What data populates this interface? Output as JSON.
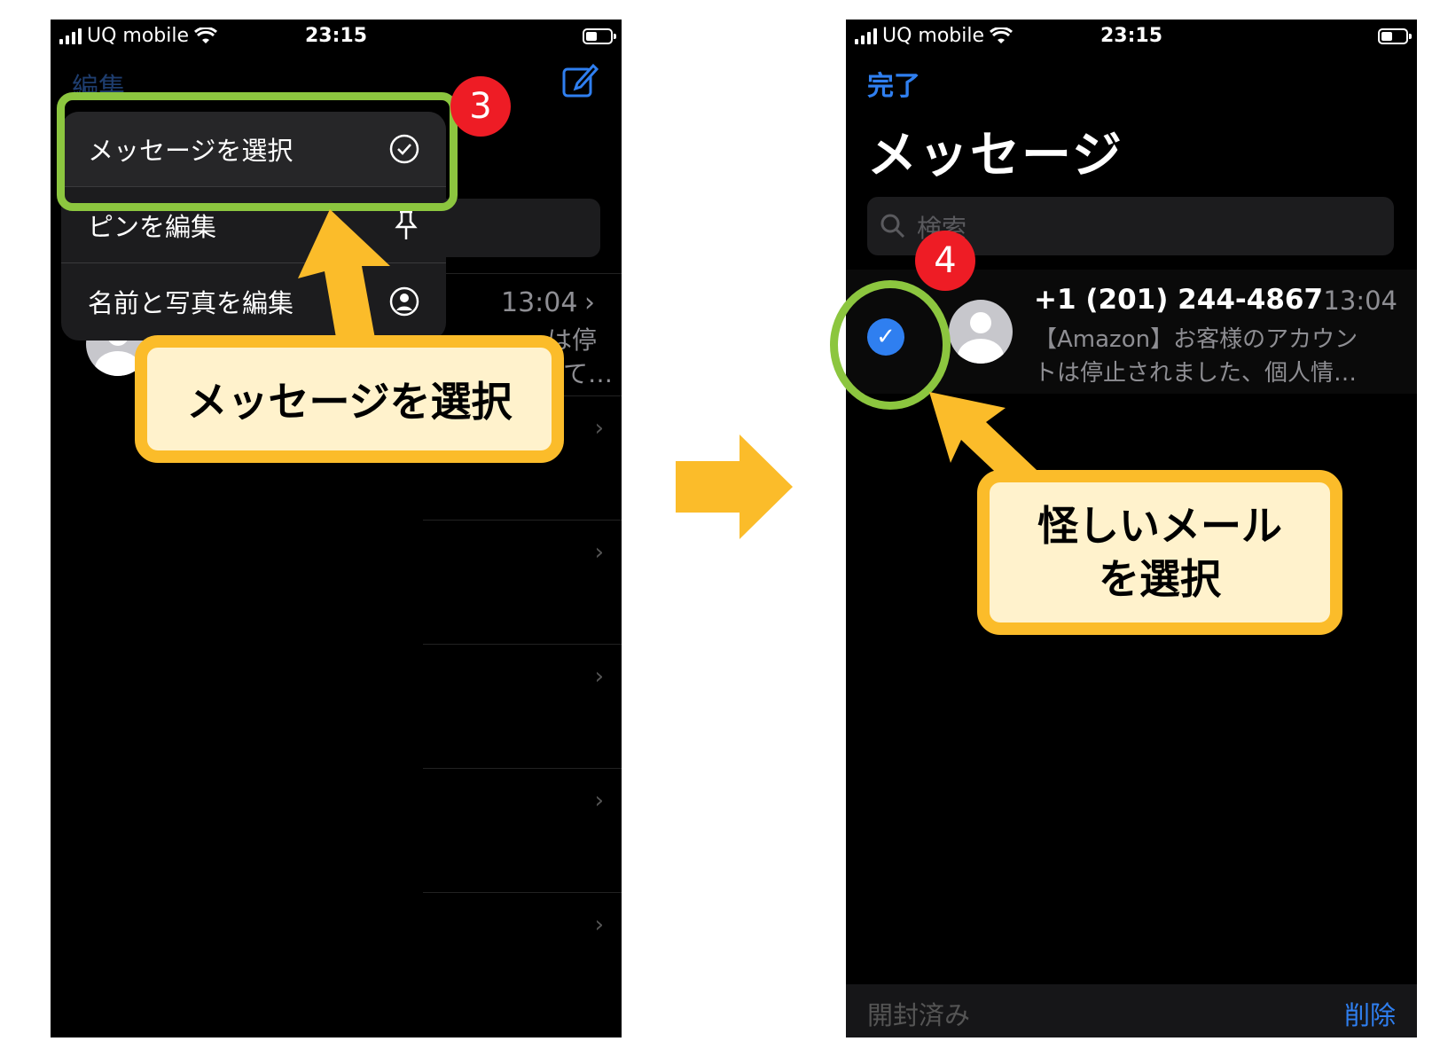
{
  "status_bar": {
    "carrier": "UQ mobile",
    "time": "23:15"
  },
  "left_phone": {
    "edit_label": "編集",
    "context_menu": {
      "items": [
        {
          "label": "メッセージを選択",
          "icon": "checkmark-circle-icon"
        },
        {
          "label": "ピンを編集",
          "icon": "pin-icon"
        },
        {
          "label": "名前と写真を編集",
          "icon": "person-circle-icon"
        }
      ]
    },
    "conversation": {
      "time": "13:04",
      "snippet_1": "は停",
      "snippet_2": "て…"
    },
    "step_badge": "3",
    "callout": "メッセージを選択"
  },
  "right_phone": {
    "done_label": "完了",
    "title": "メッセージ",
    "search_placeholder": "検索",
    "message": {
      "sender": "+1 (201) 244-4867",
      "time": "13:04",
      "preview_line1": "【Amazon】お客様のアカウン",
      "preview_line2": "トは停止されました、個人情…"
    },
    "step_badge": "4",
    "callout_line1": "怪しいメール",
    "callout_line2": "を選択",
    "toolbar": {
      "read_label": "開封済み",
      "delete_label": "削除"
    }
  },
  "colors": {
    "accent": "#2f7ff0",
    "highlight_green": "#8cc63f",
    "arrow_yellow": "#fbbc2a",
    "badge_red": "#ee1c25"
  }
}
